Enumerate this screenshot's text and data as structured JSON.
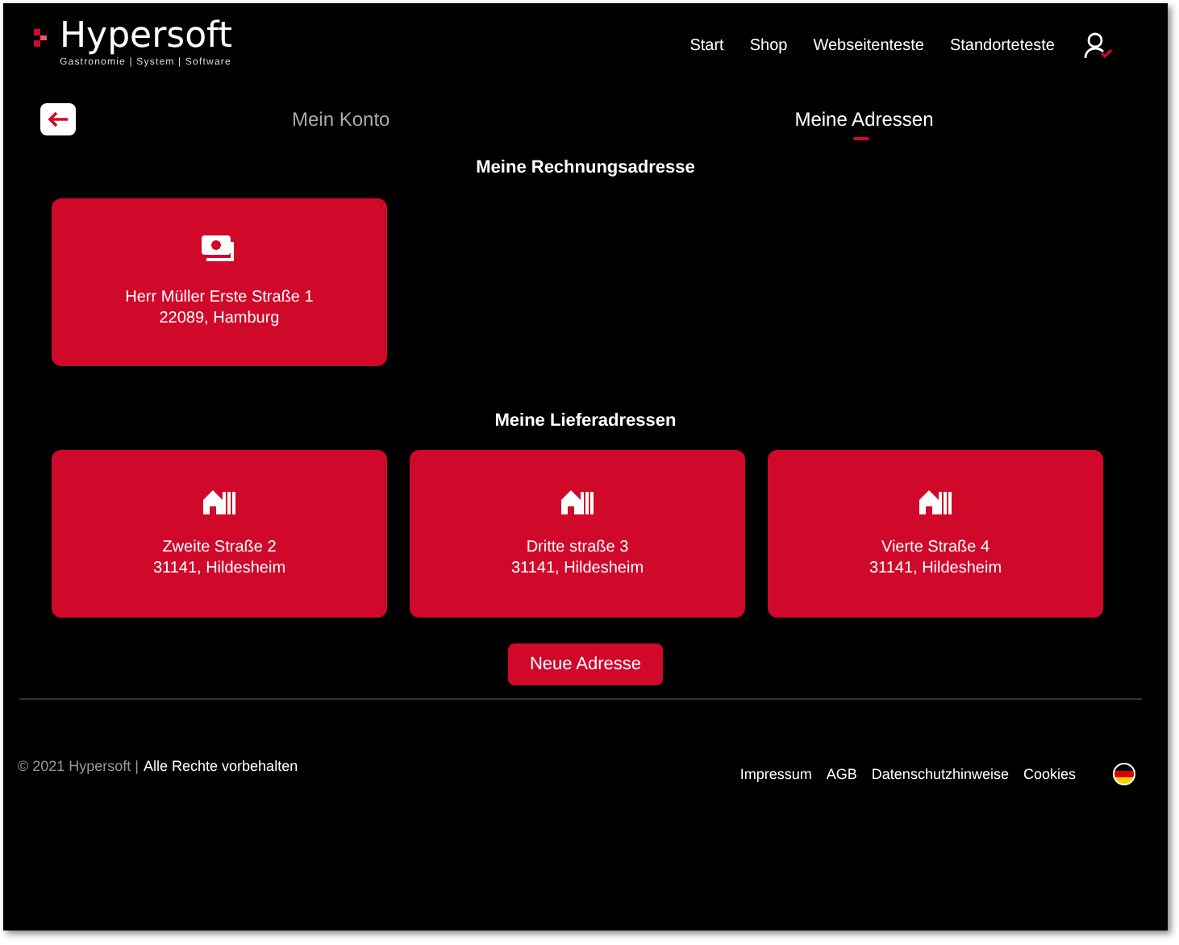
{
  "header": {
    "logo": {
      "name": "Hypersoft",
      "tagline": "Gastronomie | System | Software"
    },
    "nav": [
      {
        "label": "Start"
      },
      {
        "label": "Shop"
      },
      {
        "label": "Webseitenteste"
      },
      {
        "label": "Standorteteste"
      }
    ]
  },
  "tabs": [
    {
      "label": "Mein Konto",
      "selected": false
    },
    {
      "label": "Meine Adressen",
      "selected": true
    }
  ],
  "sections": [
    {
      "title": "Meine Rechnungsadresse",
      "cards": [
        {
          "kind": "billing",
          "line_1": "Herr Müller Erste Straße 1",
          "line_2": "22089, Hamburg"
        }
      ]
    },
    {
      "title": "Meine Lieferadressen",
      "cards": [
        {
          "kind": "delivery",
          "line_1": "Zweite Straße 2",
          "line_2": "31141, Hildesheim"
        },
        {
          "kind": "delivery",
          "line_1": "Dritte straße 3",
          "line_2": "31141, Hildesheim"
        },
        {
          "kind": "delivery",
          "line_1": "Vierte Straße 4",
          "line_2": "31141, Hildesheim"
        }
      ]
    }
  ],
  "new_address_button": "Neue Adresse",
  "footer": {
    "copyright": "© 2021 Hypersoft |",
    "rights": "Alle Rechte vorbehalten",
    "links": [
      {
        "label": "Impressum"
      },
      {
        "label": "AGB"
      },
      {
        "label": "Datenschutzhinweise"
      },
      {
        "label": "Cookies"
      }
    ]
  }
}
